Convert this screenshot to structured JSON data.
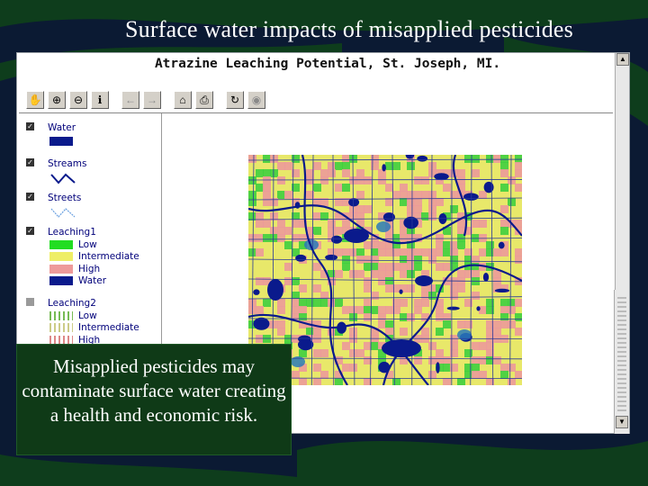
{
  "slide": {
    "title": "Surface water impacts of misapplied pesticides",
    "caption": "Misapplied pesticides may contaminate surface water creating a health and economic risk."
  },
  "app": {
    "title": "Atrazine Leaching Potential, St. Joseph, MI.",
    "toolbar": [
      {
        "icon": "hand-pan-icon",
        "glyph": "✋",
        "enabled": true
      },
      {
        "icon": "zoom-in-icon",
        "glyph": "⊕",
        "enabled": true
      },
      {
        "icon": "zoom-out-icon",
        "glyph": "⊖",
        "enabled": true
      },
      {
        "icon": "identify-icon",
        "glyph": "ℹ",
        "enabled": true
      },
      {
        "icon": "back-icon",
        "glyph": "←",
        "enabled": false
      },
      {
        "icon": "forward-icon",
        "glyph": "→",
        "enabled": false
      },
      {
        "icon": "home-icon",
        "glyph": "⌂",
        "enabled": true
      },
      {
        "icon": "print-icon",
        "glyph": "⎙",
        "enabled": true
      },
      {
        "icon": "refresh-icon",
        "glyph": "↻",
        "enabled": true
      },
      {
        "icon": "stop-icon",
        "glyph": "◉",
        "enabled": false
      }
    ],
    "legend": {
      "layers": [
        {
          "name": "Water",
          "checked": true,
          "symbol": "fill",
          "color": "#0a1a8c"
        },
        {
          "name": "Streams",
          "checked": true,
          "symbol": "line",
          "color": "#0a1a8c"
        },
        {
          "name": "Streets",
          "checked": true,
          "symbol": "line",
          "color": "#6aa0e0"
        },
        {
          "name": "Leaching1",
          "checked": true,
          "symbol": "classes",
          "classes": [
            {
              "label": "Low",
              "color": "#22dd22"
            },
            {
              "label": "Intermediate",
              "color": "#eeee66"
            },
            {
              "label": "High",
              "color": "#ee9a9a"
            },
            {
              "label": "Water",
              "color": "#0a1a8c"
            }
          ]
        },
        {
          "name": "Leaching2",
          "checked": false,
          "symbol": "classes",
          "classes": [
            {
              "label": "Low",
              "color": "#77bb55"
            },
            {
              "label": "Intermediate",
              "color": "#cccc88"
            },
            {
              "label": "High",
              "color": "#dd8888"
            }
          ]
        }
      ]
    },
    "colors": {
      "low": "#3fcf3f",
      "intermediate": "#e8e86a",
      "high": "#ec9a9a",
      "water": "#0a1a8c",
      "streets": "#2a3a9a",
      "blue_patch": "#2a7ab8"
    }
  }
}
